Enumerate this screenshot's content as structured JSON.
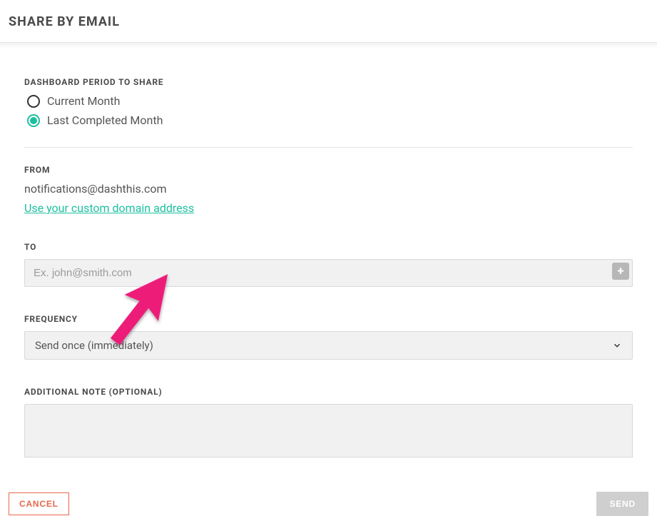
{
  "header": {
    "title": "SHARE BY EMAIL"
  },
  "period": {
    "label": "DASHBOARD PERIOD TO SHARE",
    "options": {
      "current": "Current Month",
      "last": "Last Completed Month"
    }
  },
  "from": {
    "label": "FROM",
    "value": "notifications@dashthis.com",
    "link": "Use your custom domain address"
  },
  "to": {
    "label": "TO",
    "placeholder": "Ex. john@smith.com"
  },
  "frequency": {
    "label": "FREQUENCY",
    "value": "Send once (immediately)"
  },
  "note": {
    "label": "ADDITIONAL NOTE (OPTIONAL)"
  },
  "footer": {
    "cancel": "CANCEL",
    "send": "SEND"
  },
  "colors": {
    "accent": "#1dbf9f",
    "danger": "#e8684b",
    "annotation": "#ed1e79"
  }
}
